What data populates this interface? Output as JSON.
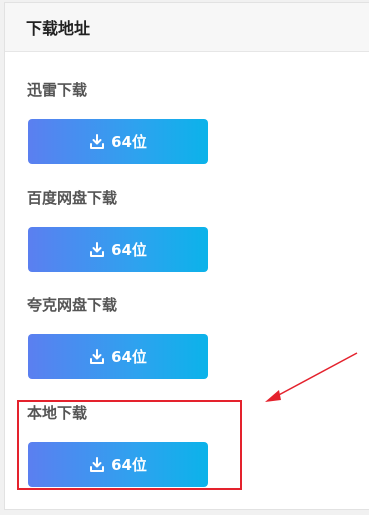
{
  "header": {
    "title": "下载地址"
  },
  "sections": [
    {
      "label": "迅雷下载",
      "button_label": "64位"
    },
    {
      "label": "百度网盘下载",
      "button_label": "64位"
    },
    {
      "label": "夸克网盘下载",
      "button_label": "64位"
    },
    {
      "label": "本地下载",
      "button_label": "64位"
    }
  ],
  "icons": {
    "button_icon": "download-icon",
    "annotation": "arrow-pointer"
  },
  "colors": {
    "button_gradient_start": "#5b7ff0",
    "button_gradient_end": "#0bb3ea",
    "annotation_red": "#e4222d"
  }
}
